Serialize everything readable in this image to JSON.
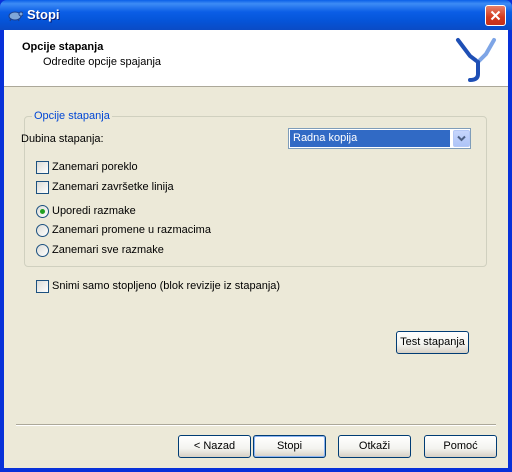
{
  "window": {
    "title": "Stopi"
  },
  "header": {
    "title": "Opcije stapanja",
    "subtitle": "Odredite opcije spajanja"
  },
  "options_group": {
    "legend": "Opcije stapanja",
    "depth_label": "Dubina stapanja:",
    "depth_selected": "Radna kopija",
    "checkboxes": [
      {
        "label": "Zanemari poreklo",
        "checked": false
      },
      {
        "label": "Zanemari završetke linija",
        "checked": false
      }
    ],
    "radios": [
      {
        "label": "Uporedi razmake",
        "selected": true
      },
      {
        "label": "Zanemari promene u razmacima",
        "selected": false
      },
      {
        "label": "Zanemari sve razmake",
        "selected": false
      }
    ]
  },
  "record_only": {
    "label": "Snimi samo stopljeno (blok revizije iz stapanja)",
    "checked": false
  },
  "test_button": "Test stapanja",
  "footer": {
    "back": "< Nazad",
    "merge": "Stopi",
    "cancel": "Otkaži",
    "help": "Pomoć"
  },
  "colors": {
    "titlebar": "#0554d8",
    "accent": "#0046d5",
    "selection": "#316ac5",
    "radio_dot": "#21a121"
  }
}
